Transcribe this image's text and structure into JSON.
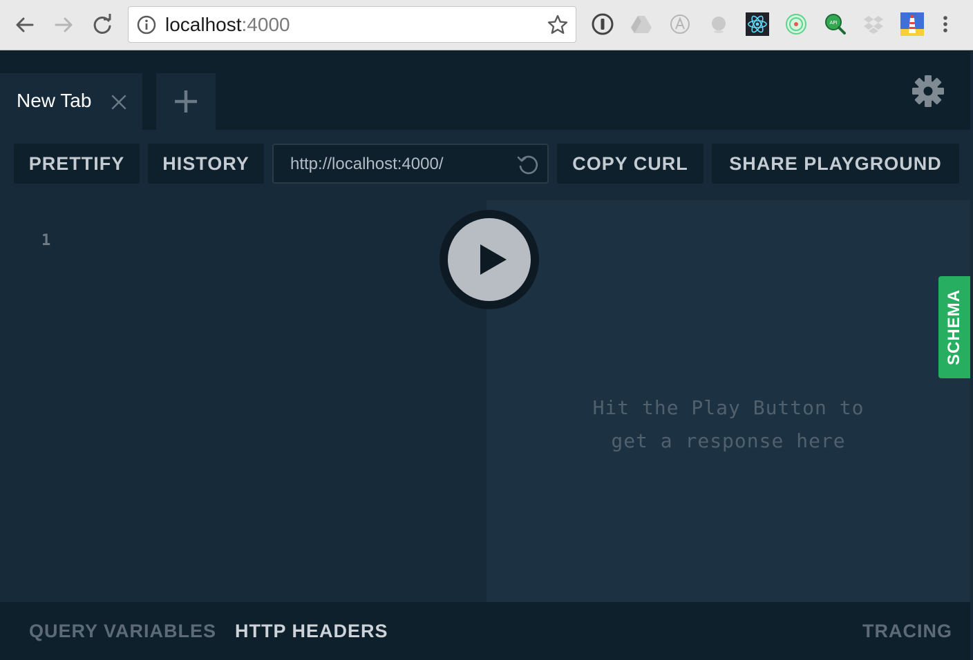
{
  "browser": {
    "url_host": "localhost",
    "url_port": ":4000",
    "extensions": [
      "onepassword-icon",
      "google-drive-icon",
      "a-circle-icon",
      "grey-dot-icon",
      "react-devtools-icon",
      "radar-icon",
      "api-search-icon",
      "dropbox-icon",
      "lighthouse-icon"
    ]
  },
  "tabs": [
    {
      "label": "New Tab"
    }
  ],
  "toolbar": {
    "prettify": "PRETTIFY",
    "history": "HISTORY",
    "endpoint": "http://localhost:4000/",
    "copy_curl": "COPY CURL",
    "share": "SHARE PLAYGROUND"
  },
  "editor": {
    "line_number": "1"
  },
  "result": {
    "hint_line1": "Hit the Play Button to",
    "hint_line2": "get a response here"
  },
  "schema_tab": "SCHEMA",
  "bottom": {
    "query_variables": "QUERY VARIABLES",
    "http_headers": "HTTP HEADERS",
    "tracing": "TRACING"
  },
  "colors": {
    "accent_green": "#27ae60",
    "bg_dark": "#0f202d",
    "panel": "#172a3a",
    "result_panel": "#1c3242"
  }
}
